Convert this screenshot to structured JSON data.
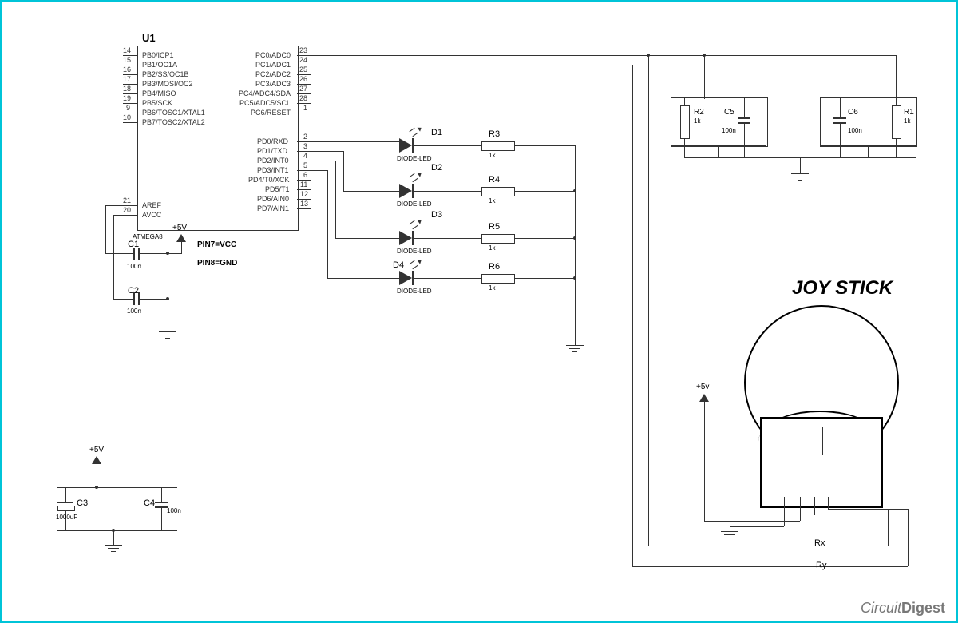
{
  "ic": {
    "ref": "U1",
    "part": "ATMEGA8",
    "note1": "PIN7=VCC",
    "note2": "PIN8=GND",
    "left_pins": [
      {
        "num": "14",
        "name": "PB0/ICP1"
      },
      {
        "num": "15",
        "name": "PB1/OC1A"
      },
      {
        "num": "16",
        "name": "PB2/SS/OC1B"
      },
      {
        "num": "17",
        "name": "PB3/MOSI/OC2"
      },
      {
        "num": "18",
        "name": "PB4/MISO"
      },
      {
        "num": "19",
        "name": "PB5/SCK"
      },
      {
        "num": "9",
        "name": "PB6/TOSC1/XTAL1"
      },
      {
        "num": "10",
        "name": "PB7/TOSC2/XTAL2"
      }
    ],
    "left_pins2": [
      {
        "num": "21",
        "name": "AREF"
      },
      {
        "num": "20",
        "name": "AVCC"
      }
    ],
    "right_pins_pc": [
      {
        "num": "23",
        "name": "PC0/ADC0"
      },
      {
        "num": "24",
        "name": "PC1/ADC1"
      },
      {
        "num": "25",
        "name": "PC2/ADC2"
      },
      {
        "num": "26",
        "name": "PC3/ADC3"
      },
      {
        "num": "27",
        "name": "PC4/ADC4/SDA"
      },
      {
        "num": "28",
        "name": "PC5/ADC5/SCL"
      },
      {
        "num": "1",
        "name": "PC6/RESET"
      }
    ],
    "right_pins_pd": [
      {
        "num": "2",
        "name": "PD0/RXD"
      },
      {
        "num": "3",
        "name": "PD1/TXD"
      },
      {
        "num": "4",
        "name": "PD2/INT0"
      },
      {
        "num": "5",
        "name": "PD3/INT1"
      },
      {
        "num": "6",
        "name": "PD4/T0/XCK"
      },
      {
        "num": "11",
        "name": "PD5/T1"
      },
      {
        "num": "12",
        "name": "PD6/AIN0"
      },
      {
        "num": "13",
        "name": "PD7/AIN1"
      }
    ]
  },
  "leds": [
    {
      "ref": "D1",
      "type": "DIODE-LED"
    },
    {
      "ref": "D2",
      "type": "DIODE-LED"
    },
    {
      "ref": "D3",
      "type": "DIODE-LED"
    },
    {
      "ref": "D4",
      "type": "DIODE-LED"
    }
  ],
  "resistors": {
    "R1": {
      "ref": "R1",
      "val": "1k"
    },
    "R2": {
      "ref": "R2",
      "val": "1k"
    },
    "R3": {
      "ref": "R3",
      "val": "1k"
    },
    "R4": {
      "ref": "R4",
      "val": "1k"
    },
    "R5": {
      "ref": "R5",
      "val": "1k"
    },
    "R6": {
      "ref": "R6",
      "val": "1k"
    }
  },
  "caps": {
    "C1": {
      "ref": "C1",
      "val": "100n"
    },
    "C2": {
      "ref": "C2",
      "val": "100n"
    },
    "C3": {
      "ref": "C3",
      "val": "1000uF"
    },
    "C4": {
      "ref": "C4",
      "val": "100n"
    },
    "C5": {
      "ref": "C5",
      "val": "100n"
    },
    "C6": {
      "ref": "C6",
      "val": "100n"
    }
  },
  "supply": {
    "v5": "+5V",
    "v5l": "+5v"
  },
  "joystick": {
    "title": "JOY STICK",
    "rx": "Rx",
    "ry": "Ry"
  },
  "watermark": {
    "a": "Circuit",
    "b": "Digest"
  }
}
